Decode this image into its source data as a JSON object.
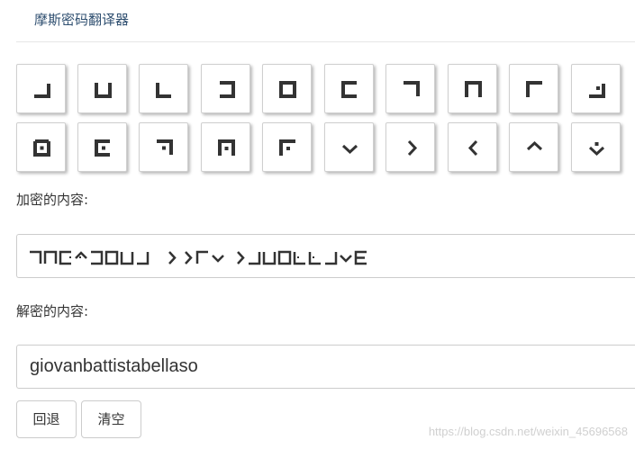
{
  "app": {
    "title": "摩斯密码翻译器"
  },
  "keypad": {
    "row1": [
      "pigpen-a",
      "pigpen-b",
      "pigpen-c",
      "pigpen-d",
      "pigpen-e",
      "pigpen-f",
      "pigpen-g",
      "pigpen-h",
      "pigpen-i",
      "pigpen-j"
    ],
    "row2": [
      "pigpen-k",
      "pigpen-l",
      "pigpen-m",
      "pigpen-n",
      "pigpen-o",
      "pigpen-s",
      "pigpen-t",
      "pigpen-u",
      "pigpen-v",
      "pigpen-w"
    ]
  },
  "encrypted": {
    "label": "加密的内容:",
    "value_description": "pigpen cipher glyph sequence"
  },
  "decrypted": {
    "label": "解密的内容:",
    "value": "giovanbattistabellaso"
  },
  "buttons": {
    "back": "回退",
    "clear": "清空"
  },
  "watermark": "https://blog.csdn.net/weixin_45696568",
  "colors": {
    "title": "#2f4f70",
    "glyph": "#333333",
    "border": "#cccccc"
  }
}
